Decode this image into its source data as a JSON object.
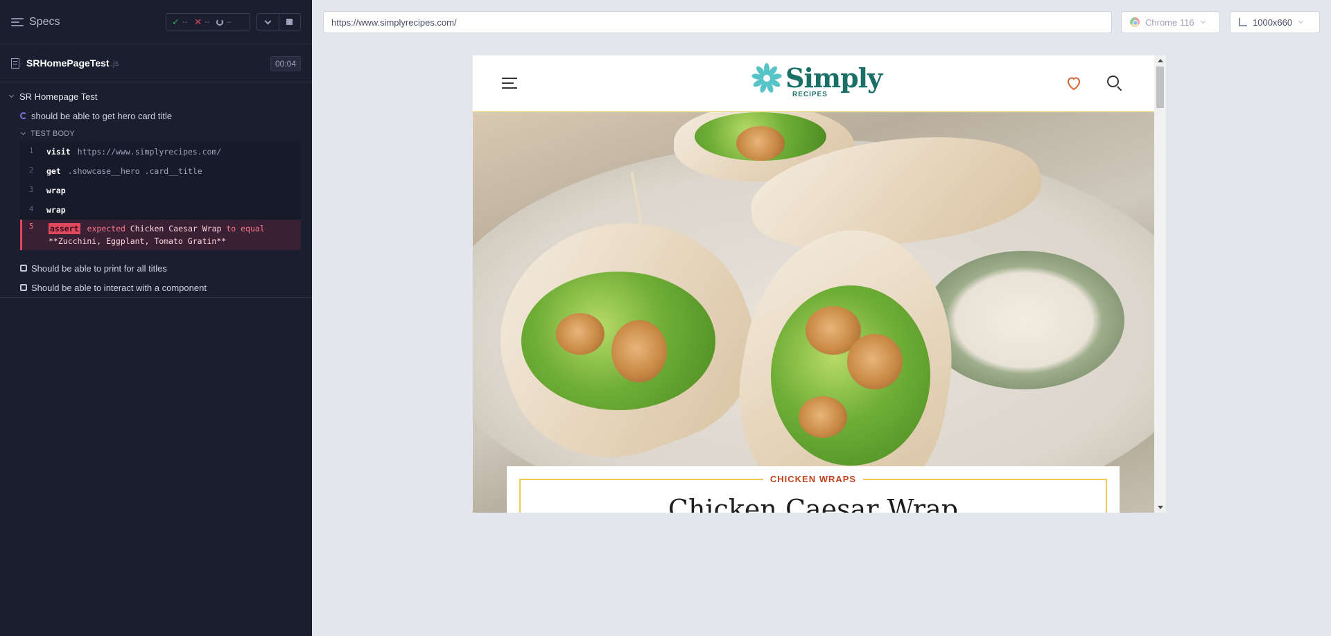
{
  "reporter": {
    "header": {
      "title": "Specs",
      "passed": "--",
      "failed": "--",
      "pending": "--"
    },
    "file": {
      "name": "SRHomePageTest",
      "ext": ".js",
      "duration": "00:04"
    },
    "suite": {
      "title": "SR Homepage Test"
    },
    "tests": [
      {
        "title": "should be able to get hero card title",
        "state": "running"
      },
      {
        "title": "Should be able to print for all titles",
        "state": "pending"
      },
      {
        "title": "Should be able to interact with a component",
        "state": "pending"
      }
    ],
    "test_body_label": "TEST BODY",
    "commands": [
      {
        "num": "1",
        "name": "visit",
        "message": "https://www.simplyrecipes.com/"
      },
      {
        "num": "2",
        "name": "get",
        "message": ".showcase__hero .card__title"
      },
      {
        "num": "3",
        "name": "wrap",
        "message": ""
      },
      {
        "num": "4",
        "name": "wrap",
        "message": ""
      }
    ],
    "failed_command": {
      "num": "5",
      "name": "assert",
      "pre": "expected",
      "actual": "Chicken Caesar Wrap",
      "mid": "to equal",
      "expected": "**Zucchini, Eggplant, Tomato Gratin**"
    }
  },
  "aut": {
    "url": "https://www.simplyrecipes.com/",
    "browser": "Chrome 116",
    "viewport": "1000x660"
  },
  "site": {
    "logo_main": "Simply",
    "logo_sub": "RECIPES",
    "card_label": "CHICKEN WRAPS",
    "card_title": "Chicken Caesar Wrap"
  },
  "colors": {
    "reporter_bg": "#1b1e2e",
    "fail": "#e0485d",
    "pass": "#2fb45a",
    "brand_teal": "#1a6f66",
    "accent_orange": "#c2411c"
  }
}
